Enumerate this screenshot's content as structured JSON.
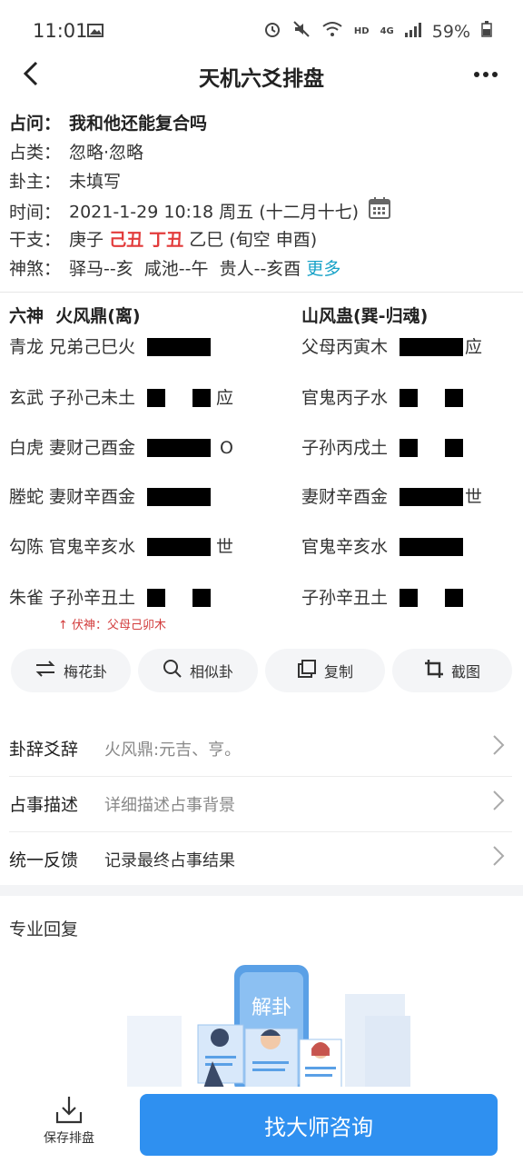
{
  "status_bar": {
    "time": "11:01",
    "hd": "HD",
    "network": "4G",
    "battery": "59%"
  },
  "nav": {
    "title": "天机六爻排盘"
  },
  "info": {
    "question_label": "占问：",
    "question": "我和他还能复合吗",
    "category_label": "占类：",
    "category": "忽略·忽略",
    "owner_label": "卦主：",
    "owner": "未填写",
    "time_label": "时间：",
    "time": "2021-1-29 10:18 周五 (十二月十七)",
    "ganzhi_label": "干支：",
    "gz_year": "庚子",
    "gz_month": "己丑",
    "gz_day": "丁丑",
    "gz_hour": "乙巳",
    "xunkong": "(旬空 申酉)",
    "shensha_label": "神煞：",
    "shensha": "驿马--亥  咸池--午  贵人--亥酉",
    "more": "更多"
  },
  "gua": {
    "left_title": "六神  火风鼎(离)",
    "right_title": "山风蛊(巽-归魂)",
    "left_lines": [
      {
        "text": "青龙 兄弟己巳火",
        "mark": ""
      },
      {
        "text": "玄武 子孙己未土",
        "mark": "应"
      },
      {
        "text": "白虎 妻财己酉金",
        "mark": "O"
      },
      {
        "text": "塍蛇 妻财辛酉金",
        "mark": ""
      },
      {
        "text": "勾陈 官鬼辛亥水",
        "mark": "世"
      },
      {
        "text": "朱雀 子孙辛丑土",
        "mark": ""
      }
    ],
    "right_lines": [
      {
        "text": "父母丙寅木",
        "mark": "应"
      },
      {
        "text": "官鬼丙子水",
        "mark": ""
      },
      {
        "text": "子孙丙戌土",
        "mark": ""
      },
      {
        "text": "妻财辛酉金",
        "mark": "世"
      },
      {
        "text": "官鬼辛亥水",
        "mark": ""
      },
      {
        "text": "子孙辛丑土",
        "mark": ""
      }
    ],
    "fushen": "↑ 伏神：父母己卯木"
  },
  "tools": [
    "梅花卦",
    "相似卦",
    "复制",
    "截图"
  ],
  "list": [
    {
      "label": "卦辞爻辞",
      "value": "火风鼎:元吉、亨。"
    },
    {
      "label": "占事描述",
      "value": "详细描述占事背景"
    },
    {
      "label": "统一反馈",
      "value": "记录最终占事结果"
    }
  ],
  "pro_reply": {
    "title": "专业回复",
    "illustration_text": "解卦"
  },
  "bottom": {
    "save_label": "保存排盘",
    "consult_label": "找大师咨询"
  },
  "colors": {
    "accent": "#2f90f0",
    "red": "#e23b3b",
    "link": "#1aa3c8"
  }
}
